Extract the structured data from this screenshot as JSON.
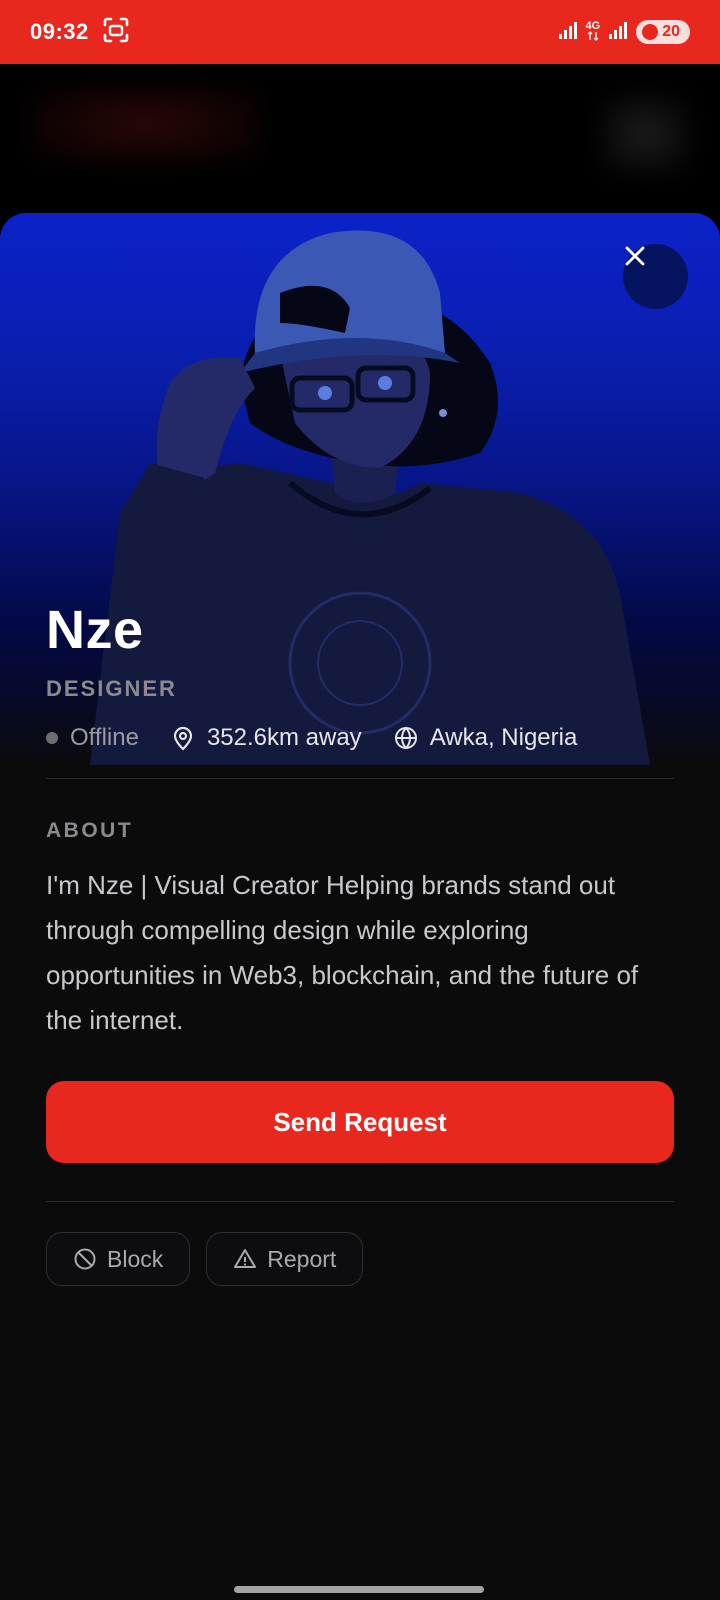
{
  "status_bar": {
    "time": "09:32",
    "network": "4G",
    "battery": "20"
  },
  "profile": {
    "name": "Nze",
    "role": "DESIGNER",
    "status": "Offline",
    "distance": "352.6km away",
    "location": "Awka, Nigeria"
  },
  "about": {
    "label": "ABOUT",
    "text": "I'm Nze | Visual Creator Helping brands stand out through compelling design while exploring opportunities in Web3, blockchain, and the future of the internet."
  },
  "actions": {
    "send_request": "Send Request",
    "block": "Block",
    "report": "Report"
  },
  "colors": {
    "accent": "#e8271f",
    "hero_top": "#0b22c9",
    "background": "#0b0b0c"
  },
  "icons": [
    "screenshot-icon",
    "signal-icon",
    "battery-icon",
    "close-icon",
    "location-pin-icon",
    "globe-icon",
    "block-icon",
    "warning-icon"
  ]
}
